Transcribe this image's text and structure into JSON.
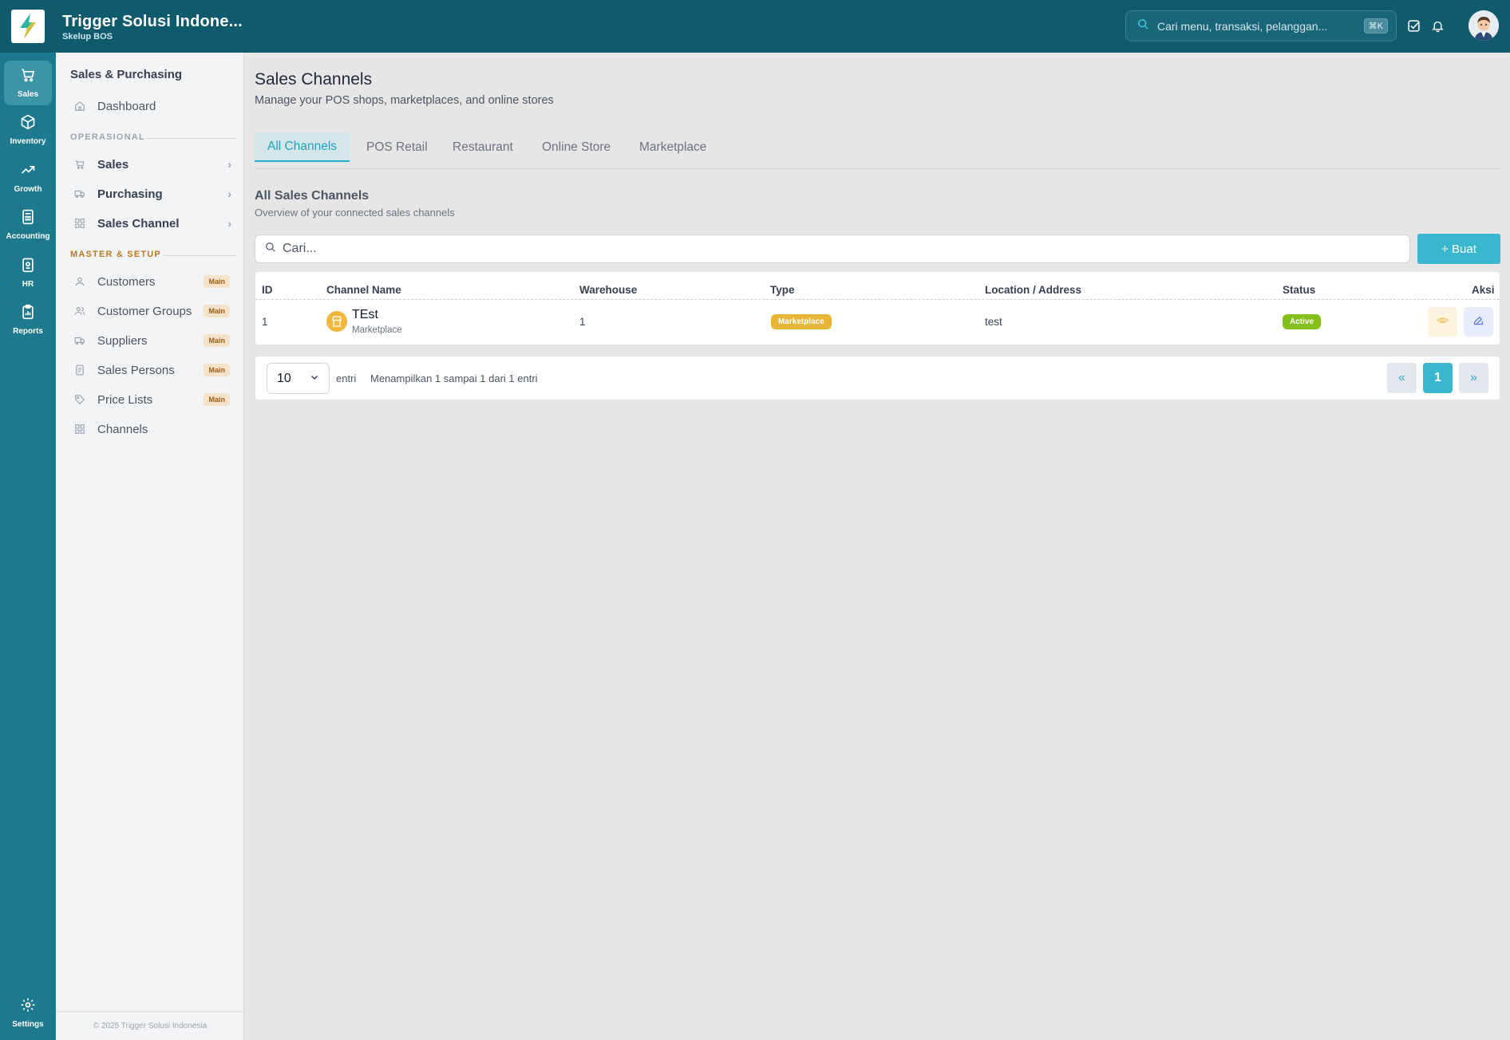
{
  "header": {
    "company": "Trigger Solusi Indone...",
    "subtitle": "Skelup BOS",
    "search_placeholder": "Cari menu, transaksi, pelanggan...",
    "shortcut": "⌘K"
  },
  "rail": {
    "items": [
      {
        "label": "Sales",
        "icon": "cart-icon",
        "active": true
      },
      {
        "label": "Inventory",
        "icon": "box-icon"
      },
      {
        "label": "Growth",
        "icon": "trending-up-icon"
      },
      {
        "label": "Accounting",
        "icon": "calculator-icon"
      },
      {
        "label": "HR",
        "icon": "id-badge-icon"
      },
      {
        "label": "Reports",
        "icon": "clipboard-chart-icon"
      }
    ],
    "settings_label": "Settings"
  },
  "sidebar": {
    "title": "Sales & Purchasing",
    "dashboard": "Dashboard",
    "section_operational": "OPERASIONAL",
    "operational": [
      {
        "label": "Sales",
        "icon": "cart-icon"
      },
      {
        "label": "Purchasing",
        "icon": "truck-icon"
      },
      {
        "label": "Sales Channel",
        "icon": "grid-icon"
      }
    ],
    "section_master": "MASTER & SETUP",
    "master": [
      {
        "label": "Customers",
        "badge": "Main",
        "icon": "user-icon"
      },
      {
        "label": "Customer Groups",
        "badge": "Main",
        "icon": "users-icon"
      },
      {
        "label": "Suppliers",
        "badge": "Main",
        "icon": "truck-icon"
      },
      {
        "label": "Sales Persons",
        "badge": "Main",
        "icon": "id-card-icon"
      },
      {
        "label": "Price Lists",
        "badge": "Main",
        "icon": "tag-icon"
      },
      {
        "label": "Channels",
        "icon": "grid-icon"
      }
    ],
    "footer": "© 2025 Trigger Solusi Indonesia"
  },
  "page": {
    "title": "Sales Channels",
    "subtitle": "Manage your POS shops, marketplaces, and online stores",
    "tabs": [
      "All Channels",
      "POS Retail",
      "Restaurant",
      "Online Store",
      "Marketplace"
    ],
    "active_tab": "All Channels",
    "section_title": "All Sales Channels",
    "section_subtitle": "Overview of your connected sales channels",
    "search_placeholder": "Cari...",
    "create_button": "+ Buat"
  },
  "table": {
    "columns": [
      "ID",
      "Channel Name",
      "Warehouse",
      "Type",
      "Location / Address",
      "Status",
      "Aksi"
    ],
    "rows": [
      {
        "id": "1",
        "name": "TEst",
        "name_sub": "Marketplace",
        "warehouse": "1",
        "type": "Marketplace",
        "location": "test",
        "status": "Active"
      }
    ]
  },
  "pagination": {
    "page_size": "10",
    "entries_label": "entri",
    "info": "Menampilkan 1 sampai 1 dari 1 entri",
    "prev": "«",
    "current": "1",
    "next": "»"
  },
  "colors": {
    "topbar": "#0f5a6c",
    "rail": "#1d7a8e",
    "accent": "#3ab7cf",
    "marketplace_badge": "#e9b534",
    "active_badge": "#84c11b"
  }
}
